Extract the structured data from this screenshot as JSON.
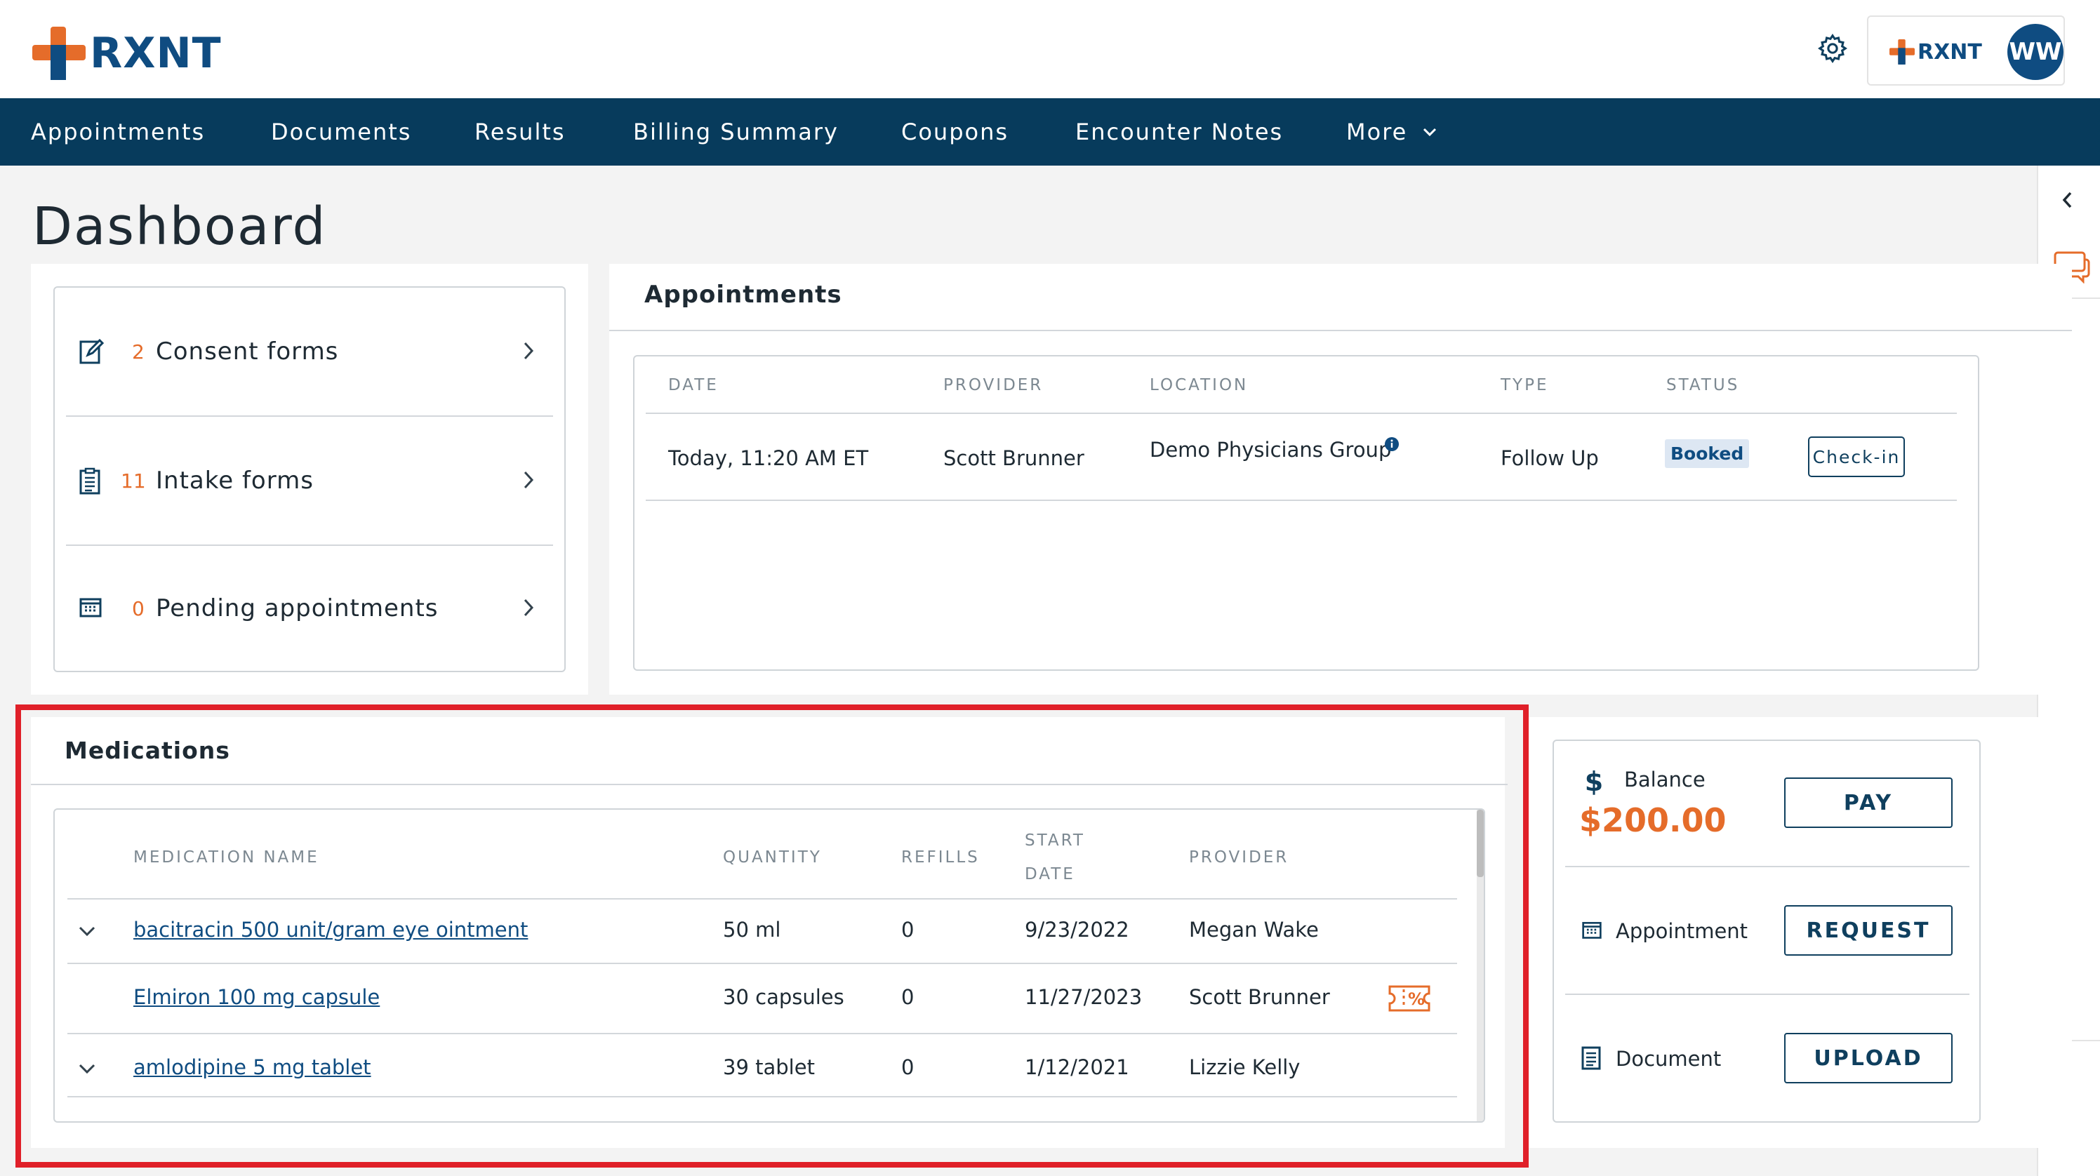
{
  "header": {
    "logo_text": "RXNT",
    "partner_logo_text": "RXNT",
    "avatar_initials": "WW"
  },
  "nav": {
    "items": [
      "Appointments",
      "Documents",
      "Results",
      "Billing Summary",
      "Coupons",
      "Encounter Notes"
    ],
    "more_label": "More"
  },
  "page_title": "Dashboard",
  "forms": [
    {
      "count": "2",
      "label": "Consent forms",
      "icon": "form-edit-icon"
    },
    {
      "count": "11",
      "label": "Intake forms",
      "icon": "clipboard-list-icon"
    },
    {
      "count": "0",
      "label": "Pending appointments",
      "icon": "calendar-icon"
    }
  ],
  "appointments": {
    "title": "Appointments",
    "columns": [
      "DATE",
      "PROVIDER",
      "LOCATION",
      "TYPE",
      "STATUS"
    ],
    "rows": [
      {
        "date": "Today, 11:20 AM ET",
        "provider": "Scott Brunner",
        "location": "Demo Physicians Group",
        "type": "Follow Up",
        "status": "Booked",
        "action": "Check-in"
      }
    ]
  },
  "medications": {
    "title": "Medications",
    "columns": {
      "name": "MEDICATION NAME",
      "quantity": "QUANTITY",
      "refills": "REFILLS",
      "start_date_1": "START",
      "start_date_2": "DATE",
      "provider": "PROVIDER"
    },
    "rows": [
      {
        "name": "bacitracin 500 unit/gram eye ointment",
        "quantity": "50 ml",
        "refills": "0",
        "start_date": "9/23/2022",
        "provider": "Megan Wake",
        "expandable": true,
        "coupon": false
      },
      {
        "name": "Elmiron 100 mg capsule",
        "quantity": "30 capsules",
        "refills": "0",
        "start_date": "11/27/2023",
        "provider": "Scott Brunner",
        "expandable": false,
        "coupon": true
      },
      {
        "name": "amlodipine 5 mg tablet",
        "quantity": "39 tablet",
        "refills": "0",
        "start_date": "1/12/2021",
        "provider": "Lizzie Kelly",
        "expandable": true,
        "coupon": false
      }
    ]
  },
  "balance": {
    "balance_label": "Balance",
    "amount": "$200.00",
    "pay_label": "PAY",
    "appointment_label": "Appointment",
    "request_label": "REQUEST",
    "document_label": "Document",
    "upload_label": "UPLOAD"
  },
  "colors": {
    "brand_navy": "#073b5c",
    "brand_orange": "#e56c2a",
    "link_blue": "#0f4c81",
    "highlight_red": "#e02029"
  }
}
